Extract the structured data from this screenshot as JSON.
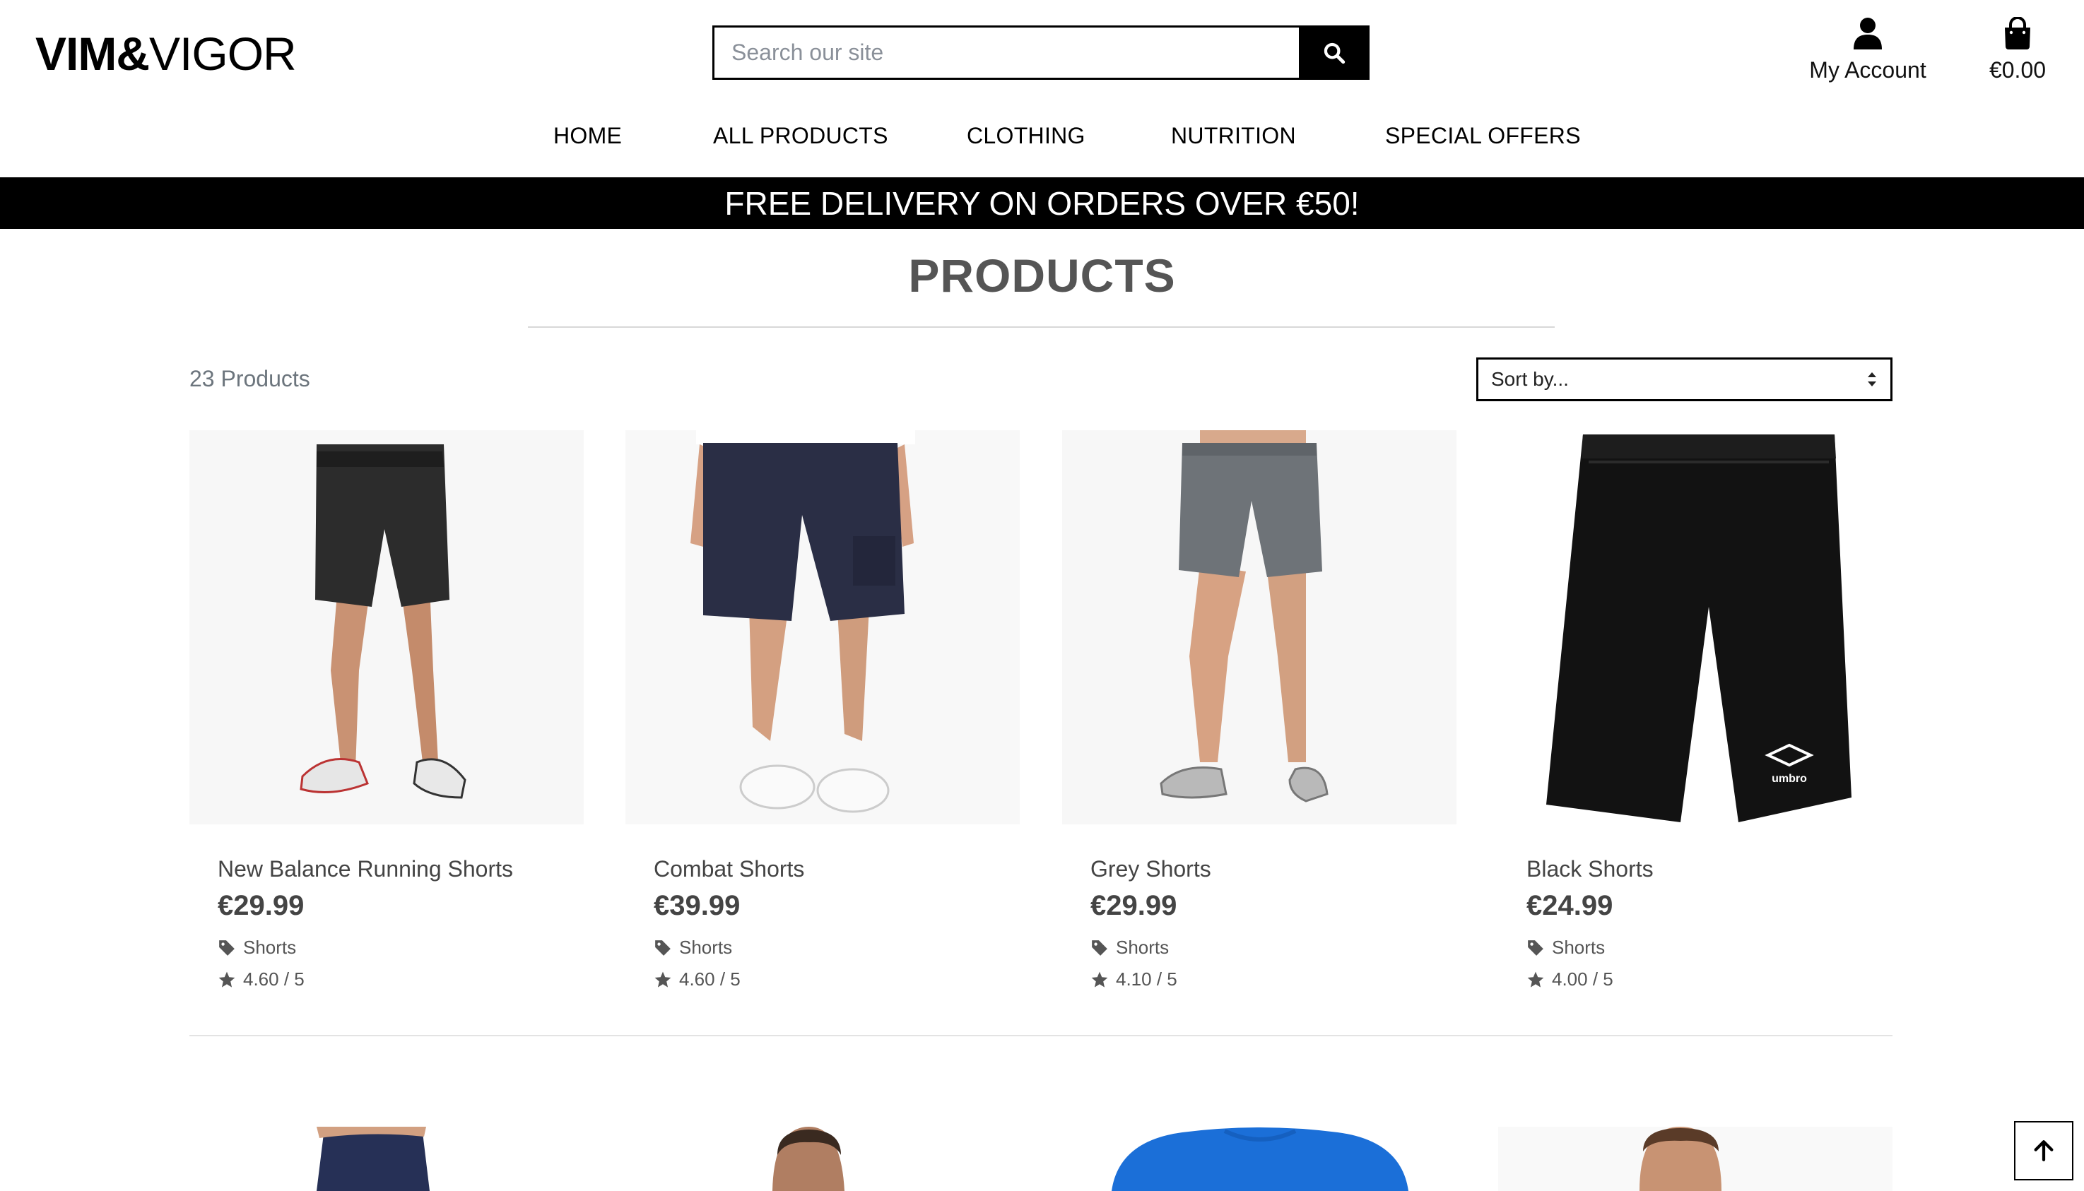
{
  "header": {
    "logo_bold": "VIM&",
    "logo_light": "VIGOR",
    "search_placeholder": "Search our site",
    "account_label": "My Account",
    "cart_total": "€0.00"
  },
  "nav": {
    "items": [
      {
        "label": "HOME"
      },
      {
        "label": "ALL PRODUCTS"
      },
      {
        "label": "CLOTHING"
      },
      {
        "label": "NUTRITION"
      },
      {
        "label": "SPECIAL OFFERS"
      }
    ]
  },
  "banner": {
    "text": "FREE DELIVERY ON ORDERS OVER €50!"
  },
  "main": {
    "title": "PRODUCTS",
    "count": "23 Products",
    "sort_label": "Sort by..."
  },
  "products": [
    {
      "name": "New Balance Running Shorts",
      "price": "€29.99",
      "category": "Shorts",
      "rating": "4.60 / 5",
      "image": "dark-running-shorts"
    },
    {
      "name": "Combat Shorts",
      "price": "€39.99",
      "category": "Shorts",
      "rating": "4.60 / 5",
      "image": "navy-cargo-shorts"
    },
    {
      "name": "Grey Shorts",
      "price": "€29.99",
      "category": "Shorts",
      "rating": "4.10 / 5",
      "image": "grey-shorts"
    },
    {
      "name": "Black Shorts",
      "price": "€24.99",
      "category": "Shorts",
      "rating": "4.00 / 5",
      "image": "black-umbro-shorts"
    }
  ],
  "icons": {
    "search": "search-icon",
    "account": "user-icon",
    "cart": "shopping-bag-icon",
    "tag": "tag-icon",
    "star": "star-icon",
    "sort": "sort-icon",
    "back_to_top": "arrow-up-icon"
  },
  "colors": {
    "banner_bg": "#000000",
    "text_muted": "#6c757d",
    "price": "#444444"
  }
}
